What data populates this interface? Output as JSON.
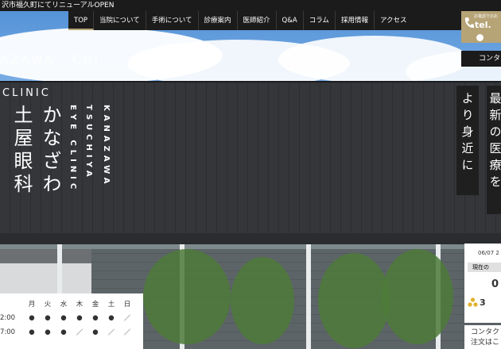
{
  "topbar": {
    "news": "沢市福久町にてリニューアルOPEN"
  },
  "nav": {
    "items": [
      "TOP",
      "当院について",
      "手術について",
      "診療案内",
      "医師紹介",
      "Q&A",
      "コラム",
      "採用情報",
      "アクセス"
    ]
  },
  "tel": {
    "small": "お電話でのお",
    "number": "tel.",
    "contact": "コンタクト"
  },
  "sign": {
    "en1": "AZAWA",
    "en1b": "CHI",
    "en2": "CLINIC",
    "jp1": "土屋眼科",
    "jp2": "かなざわ",
    "en_v1": "KANAZAWA",
    "en_v2": "TSUCHIYA",
    "en_v3": "EYE CLINIC"
  },
  "taglines": [
    "より身近に",
    "最新の医療を"
  ],
  "hours": {
    "days": [
      "月",
      "火",
      "水",
      "木",
      "金",
      "土",
      "日"
    ],
    "rows": [
      {
        "time": "2:00",
        "marks": [
          "●",
          "●",
          "●",
          "●",
          "●",
          "●",
          "／"
        ]
      },
      {
        "time": "7:00",
        "marks": [
          "●",
          "●",
          "●",
          "／",
          "●",
          "／",
          "／"
        ]
      }
    ]
  },
  "status": {
    "date": "06/07 2",
    "label": "現在の",
    "count": "0",
    "wait": "3",
    "wait_icon": "people-icon"
  },
  "contact_bottom": {
    "line1": "コンタクト",
    "line2": "注文はこ"
  },
  "colors": {
    "gold": "#b6a376",
    "dark": "#1b1b1b"
  }
}
